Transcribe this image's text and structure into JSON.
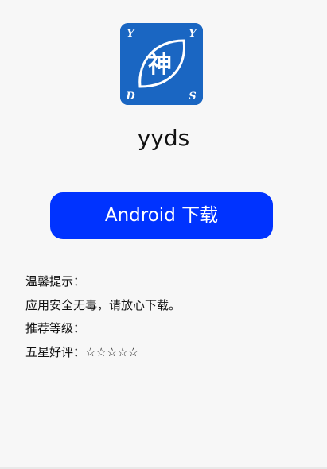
{
  "app": {
    "name": "yyds",
    "logo": {
      "center_char": "神",
      "corner_letters": [
        "Y",
        "Y",
        "D",
        "S"
      ],
      "bg_color": "#1a66c2"
    }
  },
  "download": {
    "label": "Android 下载",
    "color": "#0033ff"
  },
  "notes": {
    "tip_title": "温馨提示：",
    "safety_text": "应用安全无毒，请放心下载。",
    "rating_title": "推荐等级：",
    "rating_text": "五星好评：☆☆☆☆☆"
  }
}
